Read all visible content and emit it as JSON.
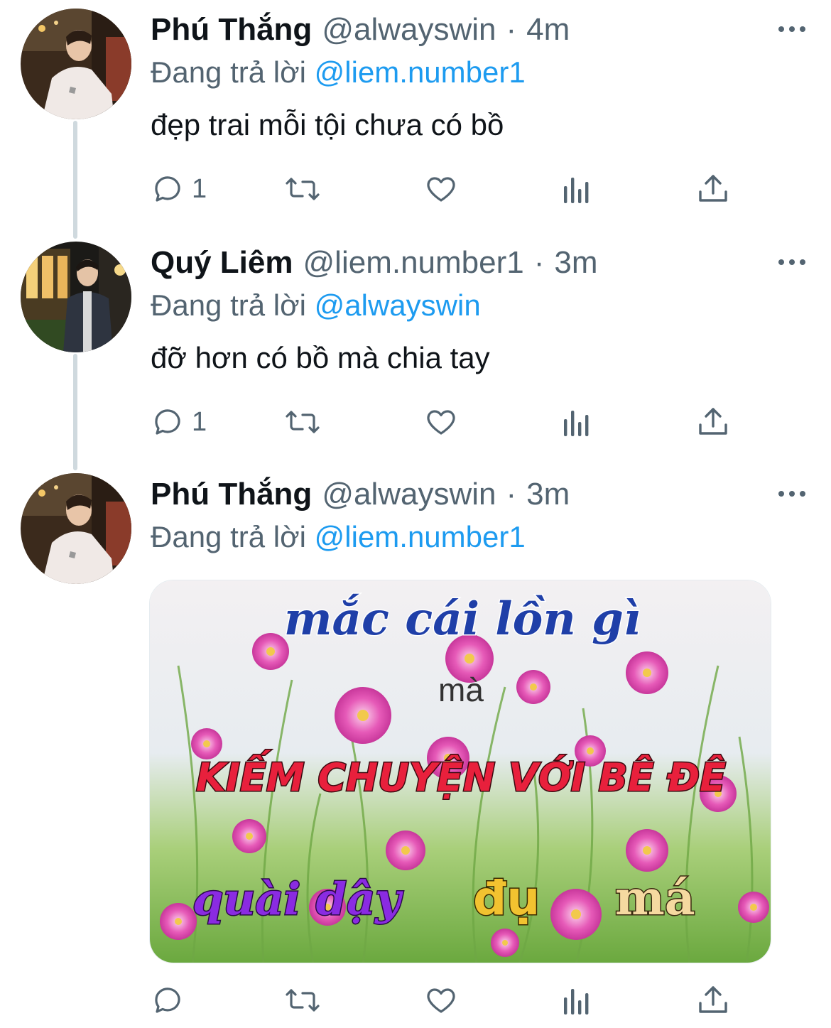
{
  "tweets": [
    {
      "display_name": "Phú Thắng",
      "handle": "@alwayswin",
      "separator": "·",
      "time": "4m",
      "reply_prefix": "Đang trả lời",
      "reply_to": "@liem.number1",
      "text": "đẹp trai mỗi tội chưa có bồ",
      "reply_count": "1",
      "avatar_icon": "person-lying-in-car-avatar"
    },
    {
      "display_name": "Quý Liêm",
      "handle": "@liem.number1",
      "separator": "·",
      "time": "3m",
      "reply_prefix": "Đang trả lời",
      "reply_to": "@alwayswin",
      "text": "đỡ hơn có bồ mà chia tay",
      "reply_count": "1",
      "avatar_icon": "person-standing-at-night-avatar"
    },
    {
      "display_name": "Phú Thắng",
      "handle": "@alwayswin",
      "separator": "·",
      "time": "3m",
      "reply_prefix": "Đang trả lời",
      "reply_to": "@liem.number1",
      "text": "",
      "reply_count": "",
      "avatar_icon": "person-lying-in-car-avatar",
      "media": {
        "line1": "mắc cái lồn gì",
        "line2": "mà",
        "line3": "KIẾM CHUYỆN VỚI BÊ ĐÊ",
        "line4a": "quài dậy",
        "line4b": "đụ",
        "line4c": "má"
      }
    }
  ],
  "icons": {
    "reply": "reply-icon",
    "retweet": "retweet-icon",
    "like": "heart-icon",
    "analytics": "analytics-icon",
    "share": "share-icon",
    "more": "more-icon"
  },
  "colors": {
    "link": "#1d9bf0",
    "secondary_text": "#536471",
    "thread_line": "#cfd9de",
    "media_line1": "#1f3fa8",
    "media_line3": "#e8203c",
    "media_line4a": "#8a2be2",
    "media_line4b": "#f2c230",
    "media_line4c": "#f5d9a0"
  }
}
